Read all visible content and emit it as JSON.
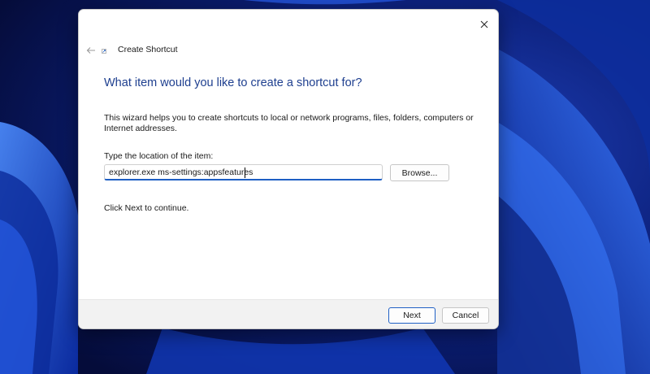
{
  "window": {
    "title": "Create Shortcut",
    "close_glyph": "✕",
    "back_glyph": "←"
  },
  "wizard": {
    "heading": "What item would you like to create a shortcut for?",
    "description": "This wizard helps you to create shortcuts to local or network programs, files, folders, computers or Internet addresses.",
    "location_label": "Type the location of the item:",
    "location_value": "explorer.exe ms-settings:appsfeatures",
    "browse_label": "Browse...",
    "continue_text": "Click Next to continue."
  },
  "footer": {
    "next_label": "Next",
    "cancel_label": "Cancel"
  },
  "icons": {
    "close": "close-icon",
    "back": "back-arrow-icon",
    "app": "shortcut-app-icon"
  },
  "colors": {
    "heading": "#1e3f8f",
    "accent": "#1e5fc4",
    "wallpaper_base": "#0a1a5c",
    "wallpaper_glow": "#2e6bff"
  }
}
